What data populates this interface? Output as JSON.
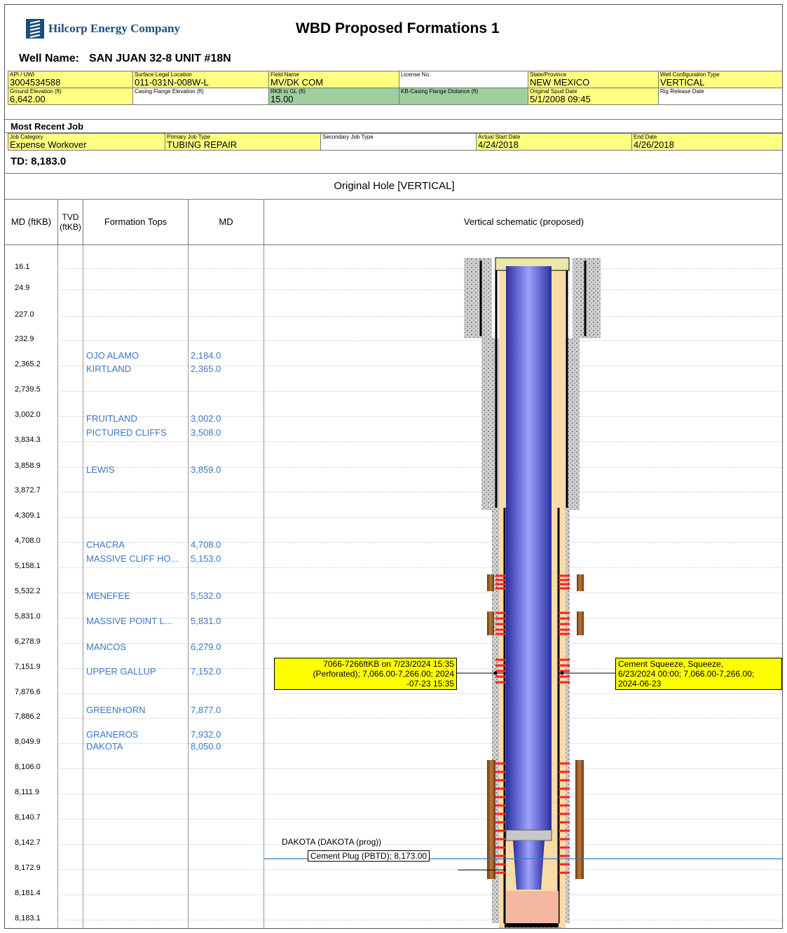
{
  "header": {
    "company": "Hilcorp Energy Company",
    "title": "WBD Proposed Formations 1",
    "well_name_label": "Well Name:",
    "well_name": "SAN JUAN 32-8 UNIT #18N"
  },
  "info_row1": [
    {
      "label": "API / UWI",
      "value": "3004534588"
    },
    {
      "label": "Surface Legal Location",
      "value": "011-031N-008W-L"
    },
    {
      "label": "Field Name",
      "value": "MV/DK COM"
    },
    {
      "label": "License No.",
      "value": ""
    },
    {
      "label": "State/Province",
      "value": "NEW MEXICO"
    },
    {
      "label": "Well Configuration Type",
      "value": "VERTICAL"
    }
  ],
  "info_row2": [
    {
      "label": "Ground Elevation (ft)",
      "value": "6,642.00"
    },
    {
      "label": "Casing Flange Elevation (ft)",
      "value": ""
    },
    {
      "label": "RKB to GL (ft)",
      "value": "15.00"
    },
    {
      "label": "KB-Casing Flange Distance (ft)",
      "value": ""
    },
    {
      "label": "Original Spud Date",
      "value": "5/1/2008 09:45"
    },
    {
      "label": "Rig Release Date",
      "value": ""
    }
  ],
  "recent_job": {
    "title": "Most Recent Job",
    "fields": [
      {
        "label": "Job Category",
        "value": "Expense Workover"
      },
      {
        "label": "Primary Job Type",
        "value": "TUBING REPAIR"
      },
      {
        "label": "Secondary Job Type",
        "value": ""
      },
      {
        "label": "Actual Start Date",
        "value": "4/24/2018"
      },
      {
        "label": "End Date",
        "value": "4/26/2018"
      }
    ]
  },
  "td": "TD: 8,183.0",
  "hole_title": "Original Hole [VERTICAL]",
  "columns": {
    "md": "MD (ftKB)",
    "tvd": "TVD (ftKB)",
    "tops": "Formation Tops",
    "md2": "MD",
    "schematic": "Vertical schematic (proposed)"
  },
  "md_scale": [
    "16.1",
    "24.9",
    "227.0",
    "232.9",
    "2,365.2",
    "2,739.5",
    "3,002.0",
    "3,834.3",
    "3,858.9",
    "3,872.7",
    "4,309.1",
    "4,708.0",
    "5,158.1",
    "5,532.2",
    "5,831.0",
    "6,278.9",
    "7,151.9",
    "7,876.6",
    "7,886.2",
    "8,049.9",
    "8,106.0",
    "8,111.9",
    "8,140.7",
    "8,142.7",
    "8,172.9",
    "8,181.4",
    "8,183.1"
  ],
  "formations": [
    {
      "name": "OJO ALAMO",
      "md": "2,184.0"
    },
    {
      "name": "KIRTLAND",
      "md": "2,365.0"
    },
    {
      "name": "FRUITLAND",
      "md": "3,002.0"
    },
    {
      "name": "PICTURED CLIFFS",
      "md": "3,508.0"
    },
    {
      "name": "LEWIS",
      "md": "3,859.0"
    },
    {
      "name": "CHACRA",
      "md": "4,708.0"
    },
    {
      "name": "MASSIVE CLIFF HO...",
      "md": "5,153.0"
    },
    {
      "name": "MENEFEE",
      "md": "5,532.0"
    },
    {
      "name": "MASSIVE POINT L...",
      "md": "5,831.0"
    },
    {
      "name": "MANCOS",
      "md": "6,279.0"
    },
    {
      "name": "UPPER GALLUP",
      "md": "7,152.0"
    },
    {
      "name": "GREENHORN",
      "md": "7,877.0"
    },
    {
      "name": "GRANEROS",
      "md": "7,932.0"
    },
    {
      "name": "DAKOTA",
      "md": "8,050.0"
    }
  ],
  "annotations": {
    "perf": [
      "7066-7266ftKB on 7/23/2024 15:35",
      "(Perforated); 7,066.00-7,266.00; 2024",
      "-07-23 15:35"
    ],
    "squeeze": [
      "Cement Squeeze, Squeeze,",
      "6/23/2024 00:00; 7,066.00-7,266.00;",
      "2024-06-23"
    ],
    "dakota": "DAKOTA (DAKOTA (prog))",
    "plug": "Cement Plug (PBTD); 8,173.00"
  },
  "colors": {
    "yellow": "#ffff80",
    "green": "#9fcf9f",
    "blue": "#3b78c4",
    "tubing": "#4a4fd0",
    "fluid": "#f8dca6",
    "perf": "#ff2020"
  }
}
